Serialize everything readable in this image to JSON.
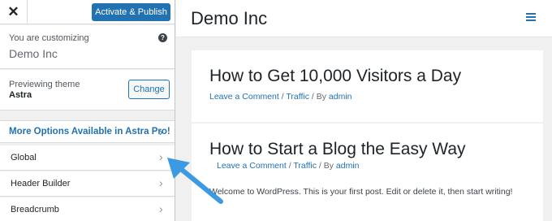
{
  "sidebar": {
    "close_icon": "close-icon",
    "publish_label": "Activate & Publish",
    "customizing_label": "You are customizing",
    "site_name": "Demo Inc",
    "help_icon": "help-icon",
    "preview_label": "Previewing theme",
    "theme_name": "Astra",
    "change_label": "Change",
    "pro_label": "More Options Available in Astra Pro!",
    "sections": [
      "Global",
      "Header Builder",
      "Breadcrumb"
    ]
  },
  "preview": {
    "site_title": "Demo Inc",
    "menu_icon": "hamburger-menu-icon",
    "posts": [
      {
        "title": "How to Get 10,000 Visitors a Day",
        "comment": "Leave a Comment",
        "sep1": " / ",
        "category": "Traffic",
        "by": " / By ",
        "author": "admin"
      },
      {
        "title": "How to Start a Blog the Easy Way",
        "comment": "Leave a Comment",
        "sep1": " / ",
        "category": "Traffic",
        "by": " / By ",
        "author": "admin",
        "excerpt": "Welcome to WordPress. This is your first post. Edit or delete it, then start writing!"
      }
    ]
  },
  "colors": {
    "accent": "#2271b1",
    "annotation_arrow": "#3b9ae1"
  }
}
